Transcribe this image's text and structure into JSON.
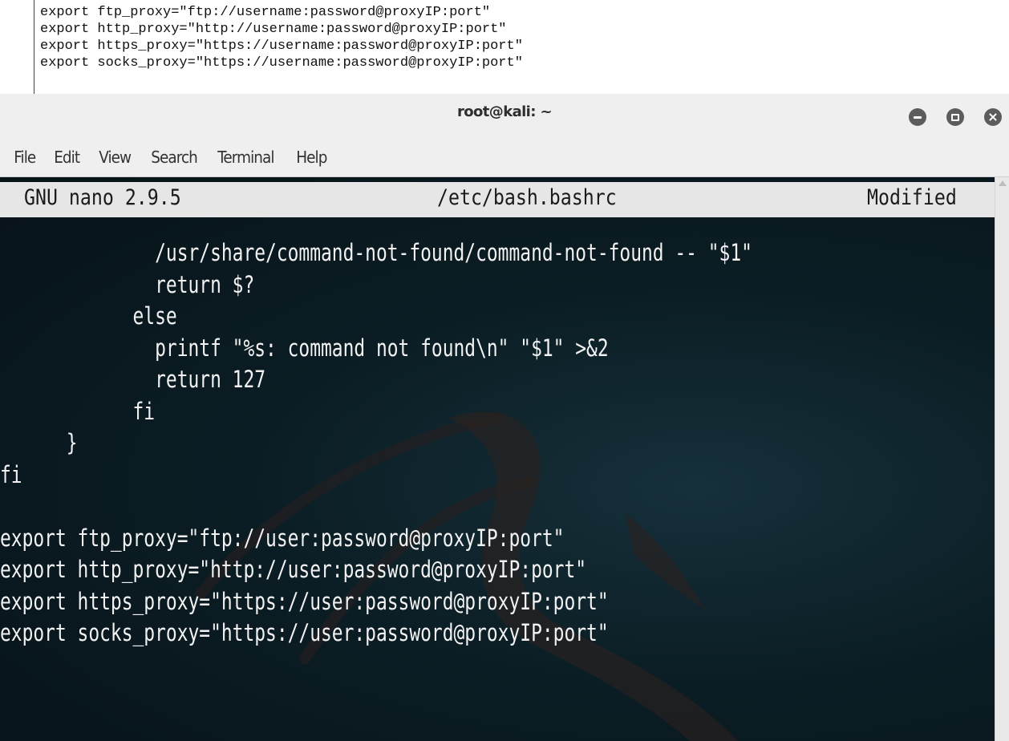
{
  "snippet": {
    "lines": [
      "export ftp_proxy=\"ftp://username:password@proxyIP:port\"",
      "export http_proxy=\"http://username:password@proxyIP:port\"",
      "export https_proxy=\"https://username:password@proxyIP:port\"",
      "export socks_proxy=\"https://username:password@proxyIP:port\""
    ]
  },
  "window": {
    "title": "root@kali: ~",
    "controls": [
      "minimize-icon",
      "maximize-icon",
      "close-icon"
    ]
  },
  "menubar": {
    "items": [
      "File",
      "Edit",
      "View",
      "Search",
      "Terminal",
      "Help"
    ]
  },
  "nano": {
    "version": "GNU nano 2.9.5",
    "filename": "/etc/bash.bashrc",
    "status": "Modified"
  },
  "editor": {
    "lines": [
      "              /usr/share/command-not-found/command-not-found -- \"$1\"",
      "              return $?",
      "            else",
      "              printf \"%s: command not found\\n\" \"$1\" >&2",
      "              return 127",
      "            fi",
      "      }",
      "fi",
      "",
      "export ftp_proxy=\"ftp://user:password@proxyIP:port\"",
      "export http_proxy=\"http://user:password@proxyIP:port\"",
      "export https_proxy=\"https://user:password@proxyIP:port\"",
      "export socks_proxy=\"https://user:password@proxyIP:port\""
    ]
  },
  "colors": {
    "terminal_bg": "#0b1d24",
    "terminal_fg": "#f2f2f2",
    "header_bg": "#e6e6e6",
    "chrome_bg": "#efefef"
  }
}
